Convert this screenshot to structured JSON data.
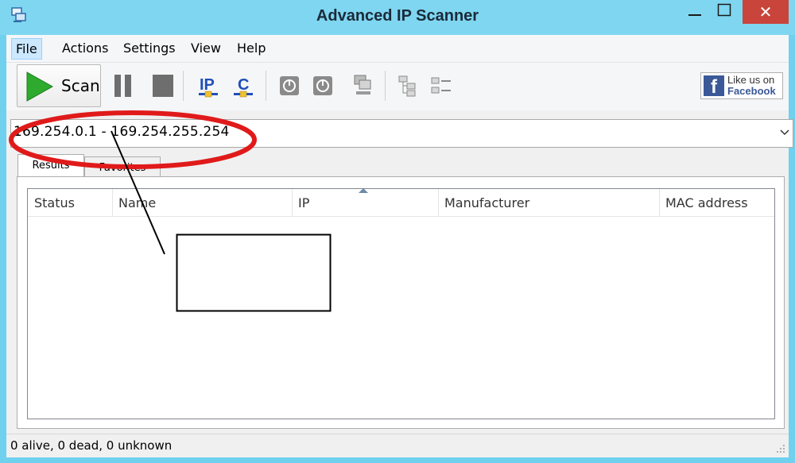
{
  "window": {
    "title": "Advanced IP Scanner",
    "close_glyph": "✕"
  },
  "menu": {
    "items": [
      "File",
      "Actions",
      "Settings",
      "View",
      "Help"
    ]
  },
  "toolbar": {
    "scan_label": "Scan",
    "icons": [
      "pause-icon",
      "stop-icon",
      "ip-icon",
      "c-icon",
      "power-on-icon",
      "power-off-icon",
      "network-computer-icon",
      "tree-view-icon",
      "list-view-icon"
    ],
    "facebook": {
      "line1": "Like us on",
      "line2": "Facebook"
    }
  },
  "range": {
    "value": "169.254.0.1 - 169.254.255.254"
  },
  "tabs": [
    {
      "label": "Results",
      "active": true
    },
    {
      "label": "Favorites",
      "active": false
    }
  ],
  "table": {
    "columns": [
      "Status",
      "Name",
      "IP",
      "Manufacturer",
      "MAC address"
    ],
    "rows": []
  },
  "status": {
    "text": "0 alive, 0 dead, 0 unknown"
  },
  "colors": {
    "titlebar": "#7fd6f0",
    "close_button": "#c9453c",
    "annotation_ellipse": "#e01a1a",
    "scan_arrow": "#2eaa2e"
  }
}
